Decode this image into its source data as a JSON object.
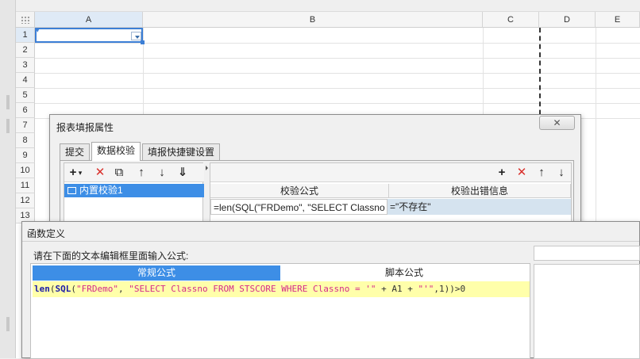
{
  "sheet": {
    "columns": [
      "A",
      "B",
      "C",
      "D",
      "E"
    ],
    "rows": [
      "1",
      "2",
      "3",
      "4",
      "5",
      "6",
      "7",
      "8",
      "9",
      "10",
      "11",
      "12",
      "13"
    ],
    "selected_cell": "A1"
  },
  "report_dialog": {
    "title": "报表填报属性",
    "close_glyph": "✕",
    "tabs": [
      "提交",
      "数据校验",
      "填报快捷键设置"
    ],
    "active_tab": "数据校验",
    "left_toolbar": {
      "add": "+",
      "add_caret": "▾",
      "delete": "✕",
      "copy": "⧉",
      "up": "↑",
      "down": "↓",
      "move": "⇓"
    },
    "list_items": [
      "内置校验1"
    ],
    "right_toolbar": {
      "add": "+",
      "delete": "✕",
      "up": "↑",
      "down": "↓"
    },
    "table": {
      "headers": [
        "校验公式",
        "校验出错信息"
      ],
      "rows": [
        {
          "formula": "=len(SQL(\"FRDemo\", \"SELECT Classno",
          "message": "=\"不存在\""
        }
      ]
    }
  },
  "function_dialog": {
    "title": "函数定义",
    "prompt": "请在下面的文本编辑框里面输入公式:",
    "tabs": [
      "常规公式",
      "脚本公式"
    ],
    "active_tab": "常规公式",
    "formula_tokens": [
      {
        "t": "len",
        "c": "kw"
      },
      {
        "t": "(",
        "c": "op"
      },
      {
        "t": "SQL",
        "c": "kw"
      },
      {
        "t": "(",
        "c": "op"
      },
      {
        "t": "\"FRDemo\"",
        "c": "str"
      },
      {
        "t": ", ",
        "c": "op"
      },
      {
        "t": "\"SELECT Classno FROM STSCORE WHERE Classno = '\"",
        "c": "str"
      },
      {
        "t": " + A1 + ",
        "c": "op"
      },
      {
        "t": "\"'\"",
        "c": "str"
      },
      {
        "t": ",1))>0",
        "c": "op"
      }
    ]
  },
  "colors": {
    "accent": "#3d8ee6",
    "selection": "#3c7fd6",
    "formula_bg": "#ffffaa",
    "delete_red": "#d9302b"
  }
}
